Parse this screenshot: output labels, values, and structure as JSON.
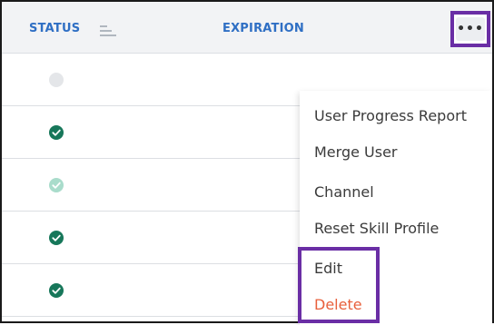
{
  "table": {
    "columns": {
      "status": "STATUS",
      "expiration": "EXPIRATION"
    },
    "rows": [
      {
        "status": "inactive"
      },
      {
        "status": "complete"
      },
      {
        "status": "complete-faded"
      },
      {
        "status": "complete"
      },
      {
        "status": "complete"
      }
    ]
  },
  "more_button": {
    "label": "•••"
  },
  "menu": {
    "items": [
      "User Progress Report",
      "Merge User",
      "Channel",
      "Reset Skill Profile",
      "Edit",
      "Delete"
    ]
  },
  "colors": {
    "header_text": "#2f6fc4",
    "check_complete": "#17775a",
    "check_faded": "#a9dccb",
    "dot_inactive": "#e4e6e9",
    "highlight": "#6a2ea5",
    "delete_text": "#e8603c"
  }
}
